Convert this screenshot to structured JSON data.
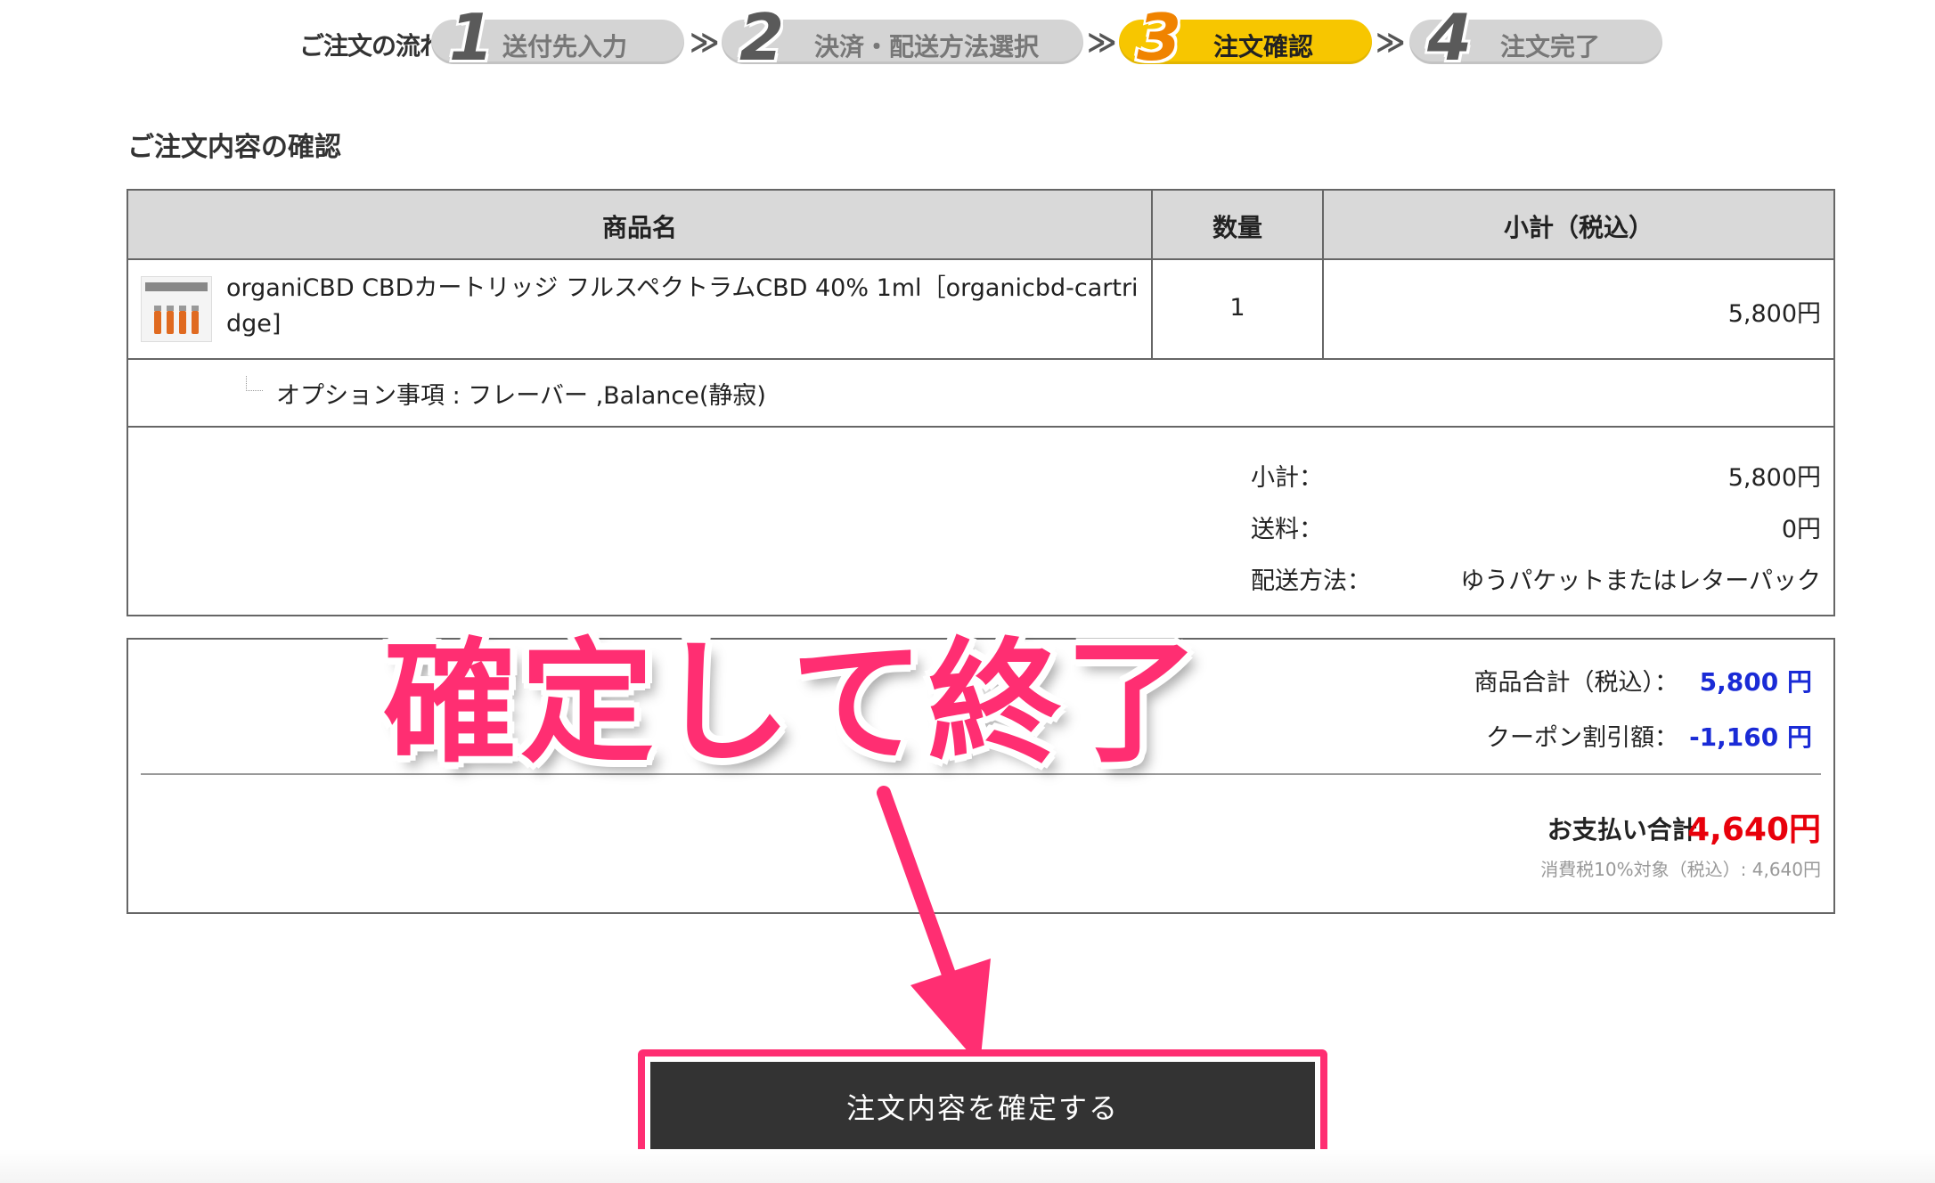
{
  "steps": {
    "label": "ご注文の流れ:",
    "items": [
      {
        "num": "1",
        "label": "送付先入力",
        "active": false
      },
      {
        "num": "2",
        "label": "決済・配送方法選択",
        "active": false
      },
      {
        "num": "3",
        "label": "注文確認",
        "active": true
      },
      {
        "num": "4",
        "label": "注文完了",
        "active": false
      }
    ],
    "separator": "≫"
  },
  "section_title": "ご注文内容の確認",
  "table": {
    "headers": {
      "name": "商品名",
      "qty": "数量",
      "subtotal": "小計（税込）"
    },
    "item": {
      "name": "organiCBD CBDカートリッジ フルスペクトラムCBD 40% 1ml［organicbd-cartridge]",
      "qty": "1",
      "price": "5,800円"
    },
    "option": "オプション事項 : フレーバー ,Balance(静寂)",
    "summary": [
      {
        "label": "小計：",
        "value": "5,800円"
      },
      {
        "label": "送料：",
        "value": "0円"
      },
      {
        "label": "配送方法：",
        "value": "ゆうパケットまたはレターパック"
      }
    ]
  },
  "totals": {
    "goods_label": "商品合計（税込）：",
    "goods_value": "5,800 円",
    "coupon_label": "クーポン割引額：",
    "coupon_value": "-1,160 円",
    "pay_label": "お支払い合計:",
    "pay_value": "4,640円",
    "tax_note": "消費税10%対象（税込）: 4,640円"
  },
  "annotation": "確定して終了",
  "confirm_button": "注文内容を確定する",
  "colors": {
    "accent_pink": "#ff2e72",
    "active_step": "#f7c600",
    "blue_value": "#1a2bd6",
    "red_total": "#e8000b",
    "button_bg": "#333333"
  }
}
